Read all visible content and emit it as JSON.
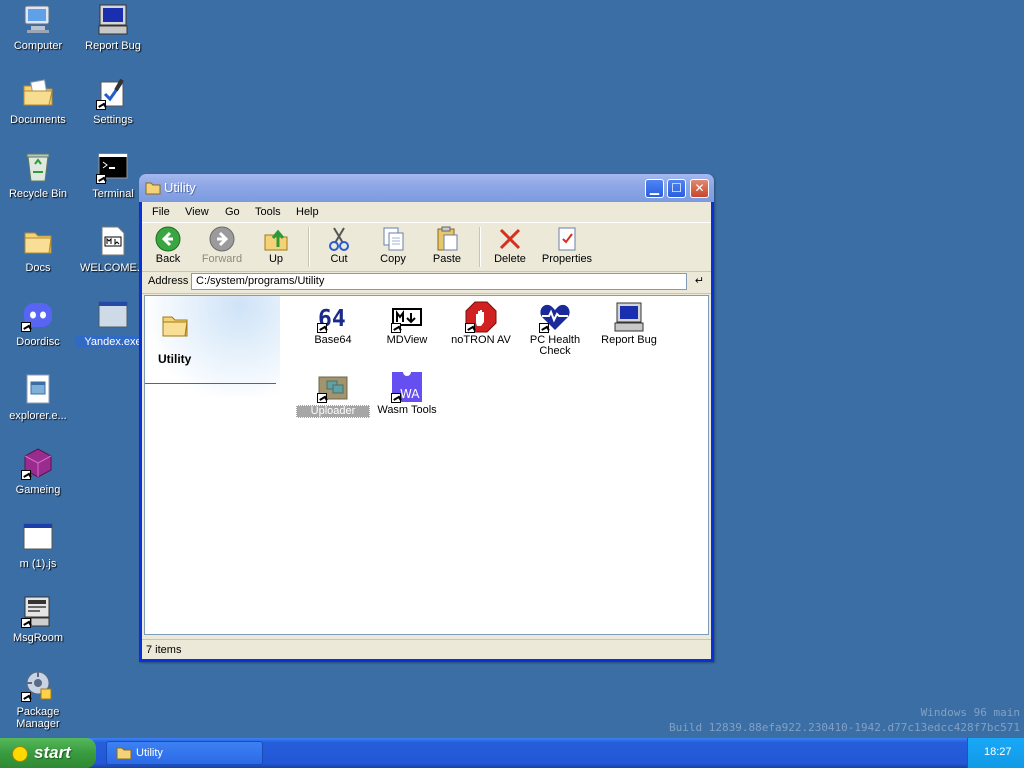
{
  "desktop": {
    "icons": [
      {
        "label": "Computer"
      },
      {
        "label": "Report Bug"
      },
      {
        "label": "Documents"
      },
      {
        "label": "Settings"
      },
      {
        "label": "Recycle Bin"
      },
      {
        "label": "Terminal"
      },
      {
        "label": "Docs"
      },
      {
        "label": "WELCOME..."
      },
      {
        "label": "Doordisc"
      },
      {
        "label": "Yandex.exe"
      },
      {
        "label": "explorer.e..."
      },
      {
        "label": "Gameing"
      },
      {
        "label": "m (1).js"
      },
      {
        "label": "MsgRoom"
      },
      {
        "label": "Package Manager"
      }
    ]
  },
  "window": {
    "title": "Utility",
    "menu": [
      "File",
      "View",
      "Go",
      "Tools",
      "Help"
    ],
    "toolbar": {
      "back": "Back",
      "forward": "Forward",
      "up": "Up",
      "cut": "Cut",
      "copy": "Copy",
      "paste": "Paste",
      "delete": "Delete",
      "properties": "Properties"
    },
    "address": {
      "label": "Address",
      "value": "C:/system/programs/Utility",
      "go": "↵"
    },
    "left_pane": {
      "title": "Utility"
    },
    "items": [
      {
        "label": "Base64",
        "icon": "base64-icon"
      },
      {
        "label": "MDView",
        "icon": "mdview-icon"
      },
      {
        "label": "noTRON AV",
        "icon": "stop-hand-icon"
      },
      {
        "label": "PC Health Check",
        "icon": "heart-icon"
      },
      {
        "label": "Report Bug",
        "icon": "computer-icon"
      },
      {
        "label": "Uploader",
        "icon": "uploader-icon"
      },
      {
        "label": "Wasm Tools",
        "icon": "wasm-icon"
      }
    ],
    "status": "7 items"
  },
  "watermark": {
    "line1": "Windows 96 main",
    "line2": "Build 12839.88efa922.230410-1942.d77c13edcc428f7bc571"
  },
  "taskbar": {
    "start": "start",
    "tasks": [
      {
        "label": "Utility"
      }
    ],
    "clock": "18:27"
  },
  "colors": {
    "desktop": "#3b6ea5",
    "titlebar": "#8ea7e6",
    "taskbar": "#245edb",
    "start": "#3a9b3f"
  }
}
